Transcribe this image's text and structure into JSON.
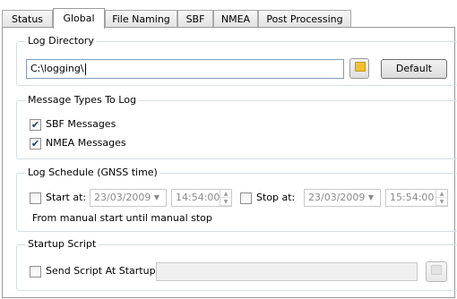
{
  "tabs": [
    {
      "label": "Status"
    },
    {
      "label": "Global"
    },
    {
      "label": "File Naming"
    },
    {
      "label": "SBF"
    },
    {
      "label": "NMEA"
    },
    {
      "label": "Post Processing"
    }
  ],
  "active_tab": "Global",
  "log_directory": {
    "title": "Log Directory",
    "path_value": "C:\\logging\\",
    "browse_icon": "folder-icon",
    "default_label": "Default"
  },
  "message_types": {
    "title": "Message Types To Log",
    "sbf_label": "SBF Messages",
    "sbf_checked": true,
    "nmea_label": "NMEA Messages",
    "nmea_checked": true
  },
  "log_schedule": {
    "title": "Log Schedule (GNSS time)",
    "start_label": "Start at:",
    "start_checked": false,
    "start_date": "23/03/2009",
    "start_time": "14:54:00",
    "stop_label": "Stop at:",
    "stop_checked": false,
    "stop_date": "23/03/2009",
    "stop_time": "15:54:00",
    "note": "From manual start until manual stop"
  },
  "startup_script": {
    "title": "Startup Script",
    "send_label": "Send Script At Startup:",
    "send_checked": false,
    "path_value": "",
    "browse_icon": "folder-icon"
  },
  "colors": {
    "group_border": "#d5dfe5",
    "input_border": "#7f9db9",
    "check_color": "#1f3b6e",
    "folder_yellow": "#f2c030"
  }
}
